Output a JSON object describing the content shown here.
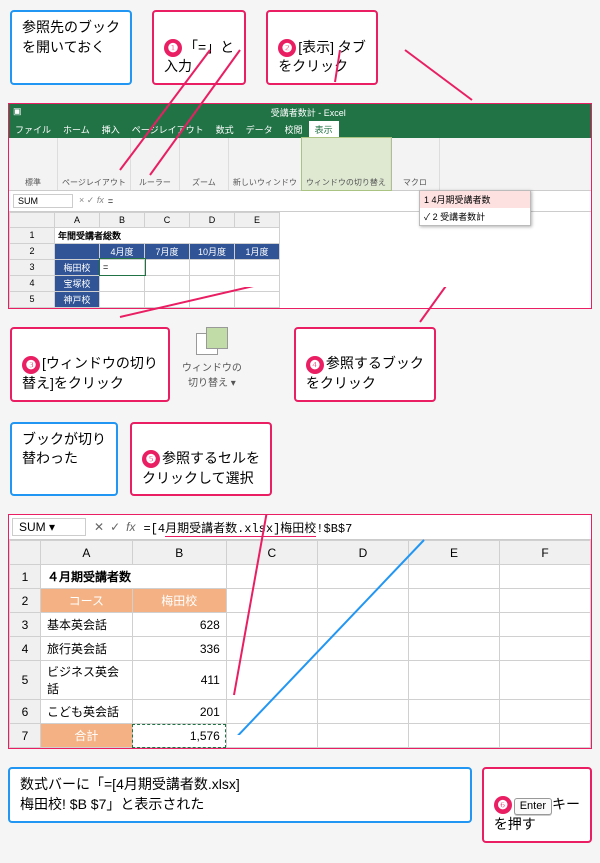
{
  "callouts": {
    "open_ref_book": "参照先のブック\nを開いておく",
    "step1": {
      "num": "❶",
      "text": "「=」と\n入力"
    },
    "step2": {
      "num": "❷",
      "text": "[表示] タブ\nをクリック"
    },
    "step3": {
      "num": "❸",
      "text": "[ウィンドウの切り\n替え]をクリック"
    },
    "step4": {
      "num": "❹",
      "text": "参照するブック\nをクリック"
    },
    "switched": "ブックが切り\n替わった",
    "step5": {
      "num": "❺",
      "text": "参照するセルを\nクリックして選択"
    },
    "formula_shown": "数式バーに「=[4月期受講者数.xlsx]\n梅田校! $B $7」と表示された",
    "step6": {
      "num": "❻",
      "key": "Enter",
      "text": "キー\nを押す"
    }
  },
  "excel1": {
    "title": "受講者数計 - Excel",
    "tabs": [
      "ファイル",
      "ホーム",
      "挿入",
      "ページレイアウト",
      "数式",
      "データ",
      "校閲",
      "表示"
    ],
    "ribbon_groups": [
      "標準",
      "ページレイアウト",
      "ルーラー",
      "ズーム",
      "新しいウィンドウ",
      "ウィンドウの切り替え",
      "マクロ"
    ],
    "dropdown_items": [
      "1 4月期受講者数",
      "2 受講者数計"
    ],
    "namebox": "SUM",
    "formula": "=",
    "headers": [
      "",
      "A",
      "B",
      "C",
      "D",
      "E"
    ],
    "table_title": "年間受講者総数",
    "row_hdrs": [
      "",
      "梅田校",
      "宝塚校",
      "神戸校"
    ],
    "col_hdrs": [
      "4月度",
      "7月度",
      "10月度",
      "1月度"
    ]
  },
  "switch_icon_label": "ウィンドウの\n切り替え ▾",
  "excel2": {
    "namebox": "SUM",
    "formula_prefix": "=[4",
    "formula_highlight": "月期受講者数.xlsx]梅田校",
    "formula_suffix": "!$B$7",
    "colhdrs": [
      "",
      "A",
      "B",
      "C",
      "D",
      "E",
      "F"
    ],
    "a1": "４月期受講者数",
    "rows": [
      {
        "r": "2",
        "a": "コース",
        "b": "梅田校",
        "hdr": true
      },
      {
        "r": "3",
        "a": "基本英会話",
        "b": "628"
      },
      {
        "r": "4",
        "a": "旅行英会話",
        "b": "336"
      },
      {
        "r": "5",
        "a": "ビジネス英会話",
        "b": "411"
      },
      {
        "r": "6",
        "a": "こども英会話",
        "b": "201"
      },
      {
        "r": "7",
        "a": "合計",
        "b": "1,576",
        "total": true
      }
    ]
  }
}
